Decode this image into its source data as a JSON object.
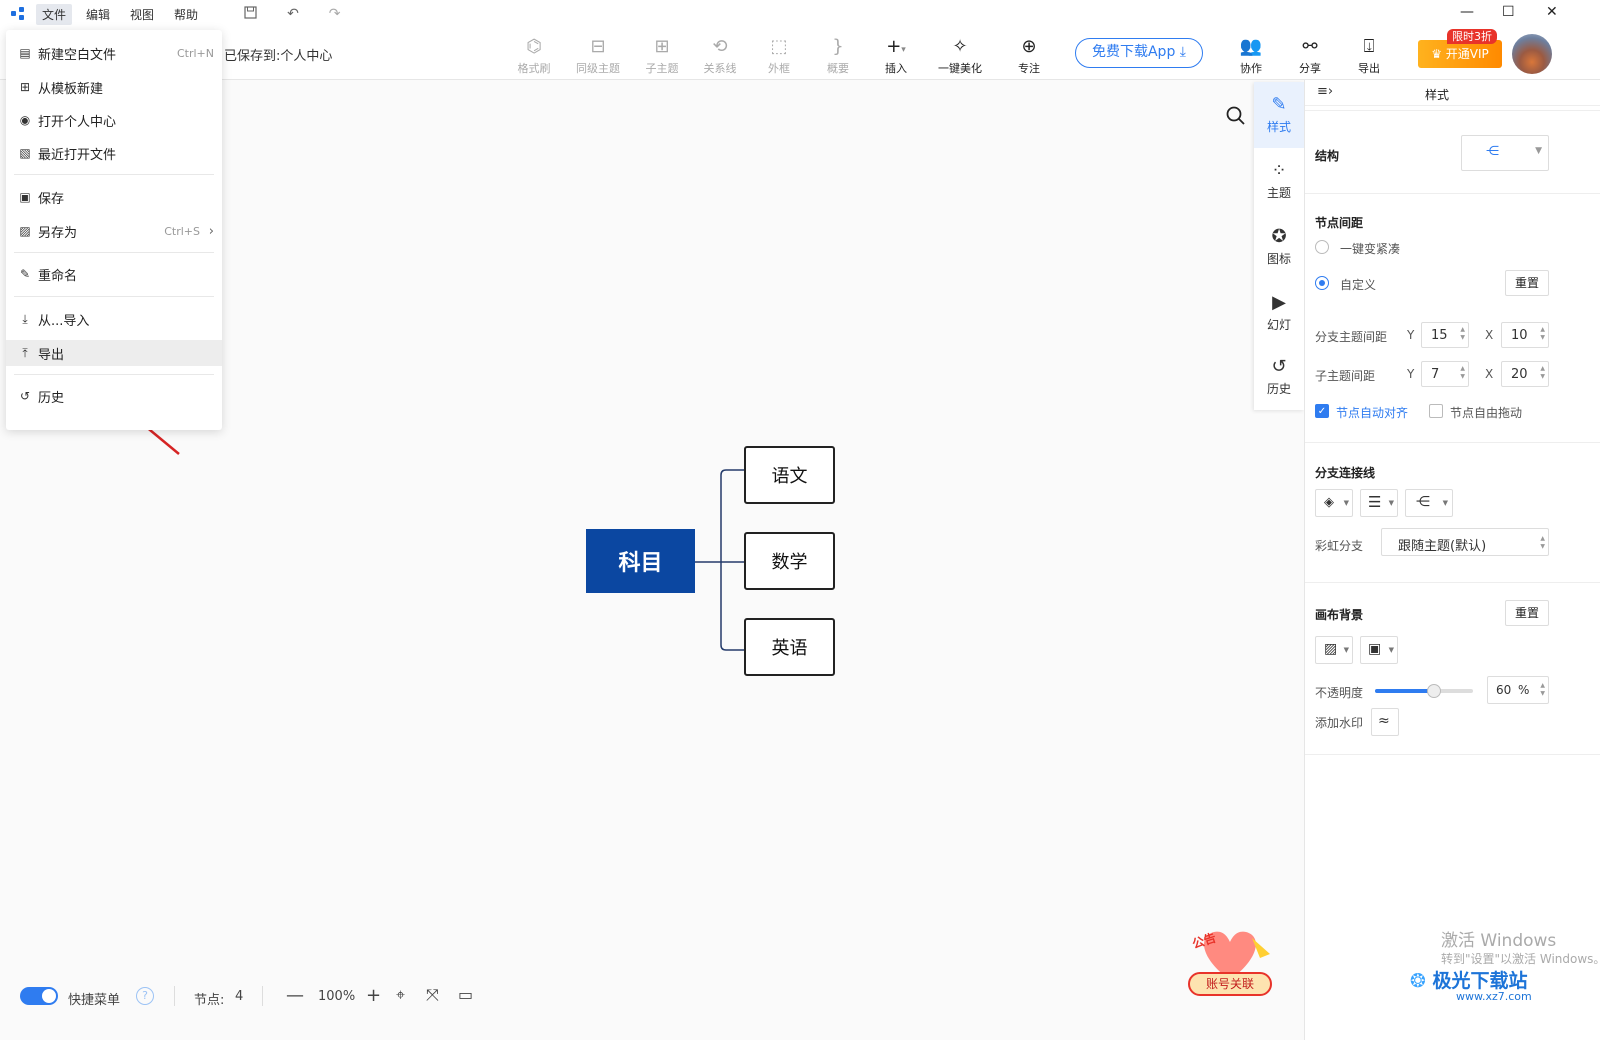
{
  "menubar": {
    "items": [
      {
        "label": "文件",
        "active": true
      },
      {
        "label": "编辑"
      },
      {
        "label": "视图"
      },
      {
        "label": "帮助"
      }
    ]
  },
  "toolbar": {
    "save_status": "已保存到:个人中心",
    "tools": [
      {
        "label": "格式刷",
        "icon": "format-painter-icon",
        "enabled": false
      },
      {
        "label": "同级主题",
        "icon": "sibling-topic-icon",
        "enabled": false
      },
      {
        "label": "子主题",
        "icon": "subtopic-icon",
        "enabled": false
      },
      {
        "label": "关系线",
        "icon": "relation-line-icon",
        "enabled": false
      },
      {
        "label": "外框",
        "icon": "boundary-icon",
        "enabled": false
      },
      {
        "label": "概要",
        "icon": "summary-icon",
        "enabled": false
      },
      {
        "label": "插入",
        "icon": "insert-icon",
        "enabled": true
      },
      {
        "label": "一键美化",
        "icon": "beautify-icon",
        "enabled": true
      },
      {
        "label": "专注",
        "icon": "focus-icon",
        "enabled": true
      }
    ],
    "download_app": "免费下载App",
    "right_tools": [
      {
        "label": "协作",
        "icon": "collaborate-icon"
      },
      {
        "label": "分享",
        "icon": "share-icon"
      },
      {
        "label": "导出",
        "icon": "export-icon"
      }
    ],
    "vip_label": "开通VIP",
    "vip_tag": "限时3折"
  },
  "file_menu": {
    "items": [
      {
        "label": "新建空白文件",
        "shortcut": "Ctrl+N",
        "icon": "new-file-icon"
      },
      {
        "label": "从模板新建",
        "shortcut": "",
        "icon": "template-icon"
      },
      {
        "label": "打开个人中心",
        "shortcut": "",
        "icon": "user-circle-icon"
      },
      {
        "label": "最近打开文件",
        "shortcut": "",
        "icon": "recent-file-icon"
      },
      {
        "label": "保存",
        "shortcut": "",
        "icon": "save-icon"
      },
      {
        "label": "另存为",
        "shortcut": "Ctrl+S",
        "icon": "save-as-icon",
        "submenu": true
      },
      {
        "label": "重命名",
        "shortcut": "",
        "icon": "rename-icon"
      },
      {
        "label": "从...导入",
        "shortcut": "",
        "icon": "import-icon"
      },
      {
        "label": "导出",
        "shortcut": "",
        "icon": "export-icon",
        "highlighted": true
      },
      {
        "label": "历史",
        "shortcut": "",
        "icon": "history-icon"
      }
    ]
  },
  "mindmap": {
    "root": "科目",
    "children": [
      "语文",
      "数学",
      "英语"
    ],
    "root_color": "#0b47a1"
  },
  "side_tabs": [
    {
      "label": "样式",
      "icon": "style-icon",
      "active": true
    },
    {
      "label": "主题",
      "icon": "theme-icon"
    },
    {
      "label": "图标",
      "icon": "sticker-icon"
    },
    {
      "label": "幻灯",
      "icon": "slideshow-icon"
    },
    {
      "label": "历史",
      "icon": "history-icon"
    }
  ],
  "panel": {
    "title": "样式",
    "structure_label": "结构",
    "node_spacing": {
      "title": "节点间距",
      "option_compact": "一键变紧凑",
      "option_custom": "自定义",
      "selected": "自定义",
      "reset": "重置",
      "branch_label": "分支主题间距",
      "branch_y": "15",
      "branch_x": "10",
      "child_label": "子主题间距",
      "child_y": "7",
      "child_x": "20",
      "y_label": "Y",
      "x_label": "X",
      "auto_align": "节点自动对齐",
      "auto_align_checked": true,
      "free_drag": "节点自由拖动",
      "free_drag_checked": false
    },
    "branch_line": {
      "title": "分支连接线",
      "rainbow_label": "彩虹分支",
      "rainbow_value": "跟随主题(默认)"
    },
    "canvas_bg": {
      "title": "画布背景",
      "reset": "重置",
      "opacity_label": "不透明度",
      "opacity_value": "60",
      "opacity_unit": "%",
      "opacity_fraction": 0.6,
      "watermark_label": "添加水印"
    }
  },
  "statusbar": {
    "quick_menu": "快捷菜单",
    "quick_menu_on": true,
    "nodes_label": "节点:",
    "nodes_count": "4",
    "zoom": "100%"
  },
  "promo": {
    "tag": "公告",
    "button": "账号关联"
  },
  "os_watermark": {
    "line1": "激活 Windows",
    "line2": "转到\"设置\"以激活 Windows。"
  },
  "site_watermark": {
    "name": "极光下载站",
    "url": "www.xz7.com"
  },
  "accent_color": "#2f7cf0"
}
